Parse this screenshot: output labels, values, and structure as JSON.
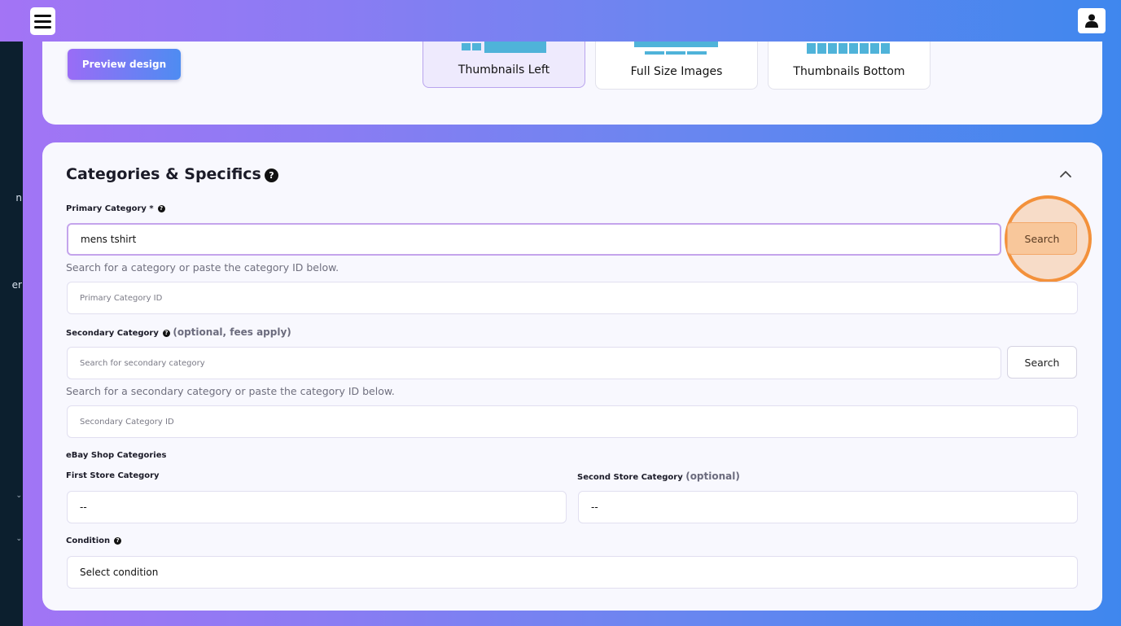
{
  "sidebar": {
    "fragments": [
      "n",
      "er"
    ]
  },
  "header": {
    "menu_icon": "hamburger-icon",
    "user_icon": "user-icon"
  },
  "design": {
    "preview_label": "Preview design",
    "layouts": [
      {
        "label": "Thumbnails Left",
        "selected": true
      },
      {
        "label": "Full Size Images",
        "selected": false
      },
      {
        "label": "Thumbnails Bottom",
        "selected": false
      }
    ]
  },
  "categories": {
    "title": "Categories & Specifics",
    "help_glyph": "?",
    "primary": {
      "label": "Primary Category *",
      "value": "mens tshirt",
      "search_label": "Search",
      "hint": "Search for a category or paste the category ID below.",
      "id_placeholder": "Primary Category ID"
    },
    "secondary": {
      "label": "Secondary Category",
      "optional": "(optional, fees apply)",
      "placeholder": "Search for secondary category",
      "search_label": "Search",
      "hint": "Search for a secondary category or paste the category ID below.",
      "id_placeholder": "Secondary Category ID"
    },
    "shop": {
      "label": "eBay Shop Categories",
      "first_label": "First Store Category",
      "first_value": "--",
      "second_label": "Second Store Category",
      "second_optional": "(optional)",
      "second_value": "--"
    },
    "condition": {
      "label": "Condition",
      "value": "Select condition"
    }
  },
  "colors": {
    "accent_gradient_start": "#a374f5",
    "accent_gradient_end": "#3f87ee",
    "highlight": "#f3913b"
  }
}
